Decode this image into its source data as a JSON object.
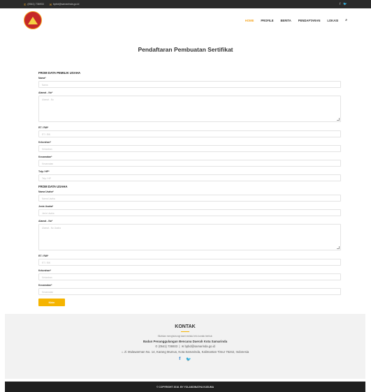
{
  "topbar": {
    "phone": "(0541) 736933",
    "email": "bpbd@samarinda.go.id"
  },
  "nav": {
    "items": [
      "HOME",
      "PROFILE",
      "BERITA",
      "PENDAFTARAN",
      "LOKASI"
    ]
  },
  "page": {
    "title": "Pendaftaran Pembuatan Sertifikat"
  },
  "form": {
    "owner_section": "FROM DATA PEMILIK USAHA",
    "owner": {
      "nama_label": "Nama*",
      "nama_ph": "Nama",
      "alamat_label": "Alamat - No*",
      "alamat_ph": "Alamat - No",
      "rt_label": "RT / RW*",
      "rt_ph": "RT / RW",
      "kel_label": "Kelurahan*",
      "kel_ph": "Kelurahan",
      "kec_label": "Kecamatan*",
      "kec_ph": "Kecamatan",
      "telp_label": "Telp / HP*",
      "telp_ph": "Telp / HP"
    },
    "business_section": "FROM DATA USAHA",
    "business": {
      "nama_label": "Nama Usaha*",
      "nama_ph": "Nama Usaha",
      "jenis_label": "Jenis Usaha*",
      "jenis_ph": "Jenis Usaha",
      "alamat_label": "Alamat - No*",
      "alamat_ph": "Alamat - No Usaha",
      "rt_label": "RT / RW*",
      "rt_ph": "RT / RW",
      "kel_label": "Kelurahan*",
      "kel_ph": "Kelurahan",
      "kec_label": "Kecamatan*",
      "kec_ph": "Kecamatan"
    },
    "submit": "Kirim"
  },
  "kontak": {
    "title": "KONTAK",
    "intro": "Silahkan menghubungi kami melalui info kontak berikut:",
    "org": "Badan Penanggulangan Bencana Daerah Kota Samarinda",
    "phone": "(0541) 736933",
    "email": "bpbd@samarinda.go.id",
    "address": "Jl. Mulawarman No. 14, Karang Mumus, Kota Samarinda, Kalimantan Timur 75242, Indonesia"
  },
  "footer": {
    "copyright": "© COPYRIGHT 2016. BY YOLANDINATHA KUSUMA"
  },
  "colors": {
    "accent": "#f5b400",
    "topbar": "#2b2b2b",
    "footer": "#1f1f1f"
  }
}
